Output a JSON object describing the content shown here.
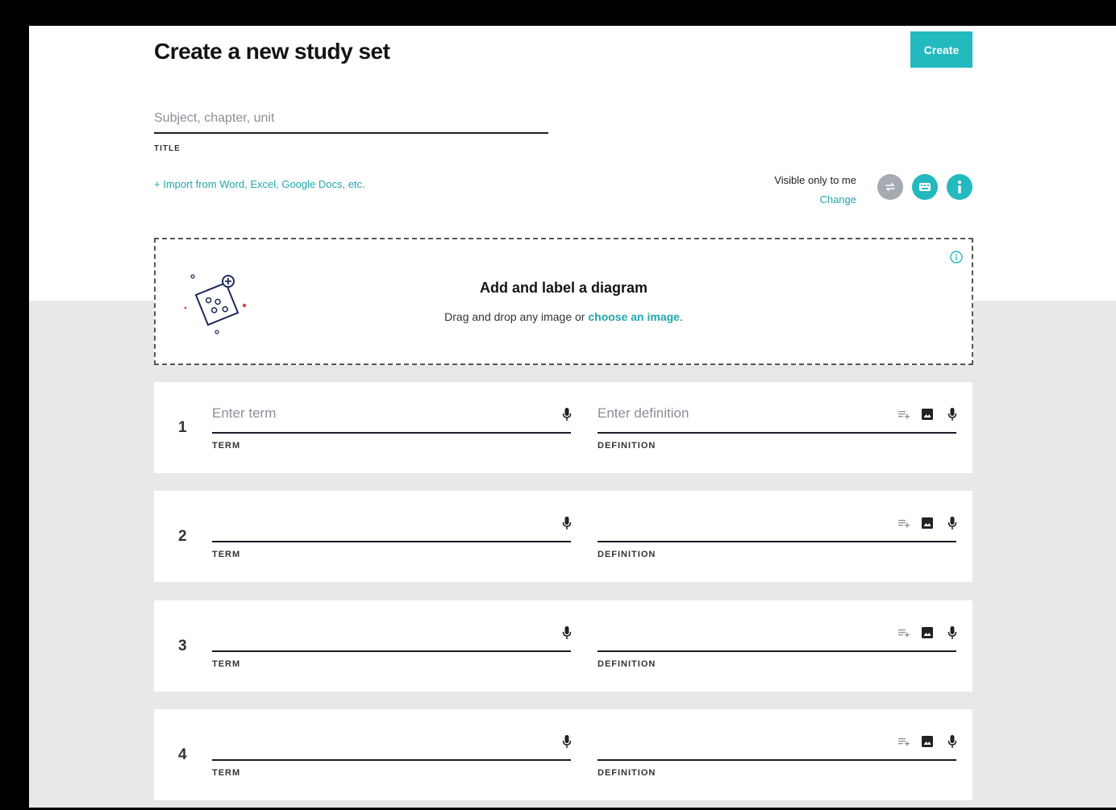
{
  "header": {
    "title": "Create a new study set",
    "create_label": "Create"
  },
  "title_field": {
    "placeholder": "Subject, chapter, unit",
    "value": "",
    "label": "TITLE"
  },
  "import_link": "+ Import from Word, Excel, Google Docs, etc.",
  "visibility": {
    "text": "Visible only to me",
    "change_label": "Change"
  },
  "diagram": {
    "heading": "Add and label a diagram",
    "sub_prefix": "Drag and drop any image or ",
    "sub_link": "choose an image",
    "sub_suffix": "."
  },
  "cards": [
    {
      "number": "1",
      "term_placeholder": "Enter term",
      "definition_placeholder": "Enter definition",
      "term_label": "TERM",
      "definition_label": "DEFINITION"
    },
    {
      "number": "2",
      "term_placeholder": "",
      "definition_placeholder": "",
      "term_label": "TERM",
      "definition_label": "DEFINITION"
    },
    {
      "number": "3",
      "term_placeholder": "",
      "definition_placeholder": "",
      "term_label": "TERM",
      "definition_label": "DEFINITION"
    },
    {
      "number": "4",
      "term_placeholder": "",
      "definition_placeholder": "",
      "term_label": "TERM",
      "definition_label": "DEFINITION"
    }
  ],
  "icons": {
    "term_mic": "microphone-icon",
    "definition_add": "playlist-add-icon",
    "definition_image": "image-icon",
    "definition_mic": "microphone-icon",
    "swap": "swap-icon",
    "keyboard": "keyboard-icon",
    "info": "info-icon"
  },
  "colors": {
    "accent": "#22b9bf",
    "link": "#22a6ad",
    "swap_button": "#a6abb1",
    "page_bg": "#e8e8e8"
  }
}
